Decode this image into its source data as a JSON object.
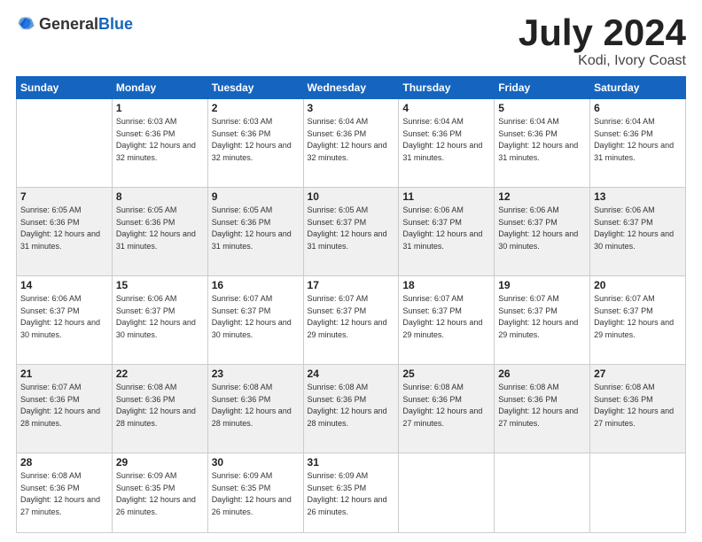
{
  "header": {
    "logo_general": "General",
    "logo_blue": "Blue",
    "month": "July 2024",
    "location": "Kodi, Ivory Coast"
  },
  "weekdays": [
    "Sunday",
    "Monday",
    "Tuesday",
    "Wednesday",
    "Thursday",
    "Friday",
    "Saturday"
  ],
  "weeks": [
    [
      {
        "day": "",
        "sunrise": "",
        "sunset": "",
        "daylight": ""
      },
      {
        "day": "1",
        "sunrise": "Sunrise: 6:03 AM",
        "sunset": "Sunset: 6:36 PM",
        "daylight": "Daylight: 12 hours and 32 minutes."
      },
      {
        "day": "2",
        "sunrise": "Sunrise: 6:03 AM",
        "sunset": "Sunset: 6:36 PM",
        "daylight": "Daylight: 12 hours and 32 minutes."
      },
      {
        "day": "3",
        "sunrise": "Sunrise: 6:04 AM",
        "sunset": "Sunset: 6:36 PM",
        "daylight": "Daylight: 12 hours and 32 minutes."
      },
      {
        "day": "4",
        "sunrise": "Sunrise: 6:04 AM",
        "sunset": "Sunset: 6:36 PM",
        "daylight": "Daylight: 12 hours and 31 minutes."
      },
      {
        "day": "5",
        "sunrise": "Sunrise: 6:04 AM",
        "sunset": "Sunset: 6:36 PM",
        "daylight": "Daylight: 12 hours and 31 minutes."
      },
      {
        "day": "6",
        "sunrise": "Sunrise: 6:04 AM",
        "sunset": "Sunset: 6:36 PM",
        "daylight": "Daylight: 12 hours and 31 minutes."
      }
    ],
    [
      {
        "day": "7",
        "sunrise": "Sunrise: 6:05 AM",
        "sunset": "Sunset: 6:36 PM",
        "daylight": "Daylight: 12 hours and 31 minutes."
      },
      {
        "day": "8",
        "sunrise": "Sunrise: 6:05 AM",
        "sunset": "Sunset: 6:36 PM",
        "daylight": "Daylight: 12 hours and 31 minutes."
      },
      {
        "day": "9",
        "sunrise": "Sunrise: 6:05 AM",
        "sunset": "Sunset: 6:36 PM",
        "daylight": "Daylight: 12 hours and 31 minutes."
      },
      {
        "day": "10",
        "sunrise": "Sunrise: 6:05 AM",
        "sunset": "Sunset: 6:37 PM",
        "daylight": "Daylight: 12 hours and 31 minutes."
      },
      {
        "day": "11",
        "sunrise": "Sunrise: 6:06 AM",
        "sunset": "Sunset: 6:37 PM",
        "daylight": "Daylight: 12 hours and 31 minutes."
      },
      {
        "day": "12",
        "sunrise": "Sunrise: 6:06 AM",
        "sunset": "Sunset: 6:37 PM",
        "daylight": "Daylight: 12 hours and 30 minutes."
      },
      {
        "day": "13",
        "sunrise": "Sunrise: 6:06 AM",
        "sunset": "Sunset: 6:37 PM",
        "daylight": "Daylight: 12 hours and 30 minutes."
      }
    ],
    [
      {
        "day": "14",
        "sunrise": "Sunrise: 6:06 AM",
        "sunset": "Sunset: 6:37 PM",
        "daylight": "Daylight: 12 hours and 30 minutes."
      },
      {
        "day": "15",
        "sunrise": "Sunrise: 6:06 AM",
        "sunset": "Sunset: 6:37 PM",
        "daylight": "Daylight: 12 hours and 30 minutes."
      },
      {
        "day": "16",
        "sunrise": "Sunrise: 6:07 AM",
        "sunset": "Sunset: 6:37 PM",
        "daylight": "Daylight: 12 hours and 30 minutes."
      },
      {
        "day": "17",
        "sunrise": "Sunrise: 6:07 AM",
        "sunset": "Sunset: 6:37 PM",
        "daylight": "Daylight: 12 hours and 29 minutes."
      },
      {
        "day": "18",
        "sunrise": "Sunrise: 6:07 AM",
        "sunset": "Sunset: 6:37 PM",
        "daylight": "Daylight: 12 hours and 29 minutes."
      },
      {
        "day": "19",
        "sunrise": "Sunrise: 6:07 AM",
        "sunset": "Sunset: 6:37 PM",
        "daylight": "Daylight: 12 hours and 29 minutes."
      },
      {
        "day": "20",
        "sunrise": "Sunrise: 6:07 AM",
        "sunset": "Sunset: 6:37 PM",
        "daylight": "Daylight: 12 hours and 29 minutes."
      }
    ],
    [
      {
        "day": "21",
        "sunrise": "Sunrise: 6:07 AM",
        "sunset": "Sunset: 6:36 PM",
        "daylight": "Daylight: 12 hours and 28 minutes."
      },
      {
        "day": "22",
        "sunrise": "Sunrise: 6:08 AM",
        "sunset": "Sunset: 6:36 PM",
        "daylight": "Daylight: 12 hours and 28 minutes."
      },
      {
        "day": "23",
        "sunrise": "Sunrise: 6:08 AM",
        "sunset": "Sunset: 6:36 PM",
        "daylight": "Daylight: 12 hours and 28 minutes."
      },
      {
        "day": "24",
        "sunrise": "Sunrise: 6:08 AM",
        "sunset": "Sunset: 6:36 PM",
        "daylight": "Daylight: 12 hours and 28 minutes."
      },
      {
        "day": "25",
        "sunrise": "Sunrise: 6:08 AM",
        "sunset": "Sunset: 6:36 PM",
        "daylight": "Daylight: 12 hours and 27 minutes."
      },
      {
        "day": "26",
        "sunrise": "Sunrise: 6:08 AM",
        "sunset": "Sunset: 6:36 PM",
        "daylight": "Daylight: 12 hours and 27 minutes."
      },
      {
        "day": "27",
        "sunrise": "Sunrise: 6:08 AM",
        "sunset": "Sunset: 6:36 PM",
        "daylight": "Daylight: 12 hours and 27 minutes."
      }
    ],
    [
      {
        "day": "28",
        "sunrise": "Sunrise: 6:08 AM",
        "sunset": "Sunset: 6:36 PM",
        "daylight": "Daylight: 12 hours and 27 minutes."
      },
      {
        "day": "29",
        "sunrise": "Sunrise: 6:09 AM",
        "sunset": "Sunset: 6:35 PM",
        "daylight": "Daylight: 12 hours and 26 minutes."
      },
      {
        "day": "30",
        "sunrise": "Sunrise: 6:09 AM",
        "sunset": "Sunset: 6:35 PM",
        "daylight": "Daylight: 12 hours and 26 minutes."
      },
      {
        "day": "31",
        "sunrise": "Sunrise: 6:09 AM",
        "sunset": "Sunset: 6:35 PM",
        "daylight": "Daylight: 12 hours and 26 minutes."
      },
      {
        "day": "",
        "sunrise": "",
        "sunset": "",
        "daylight": ""
      },
      {
        "day": "",
        "sunrise": "",
        "sunset": "",
        "daylight": ""
      },
      {
        "day": "",
        "sunrise": "",
        "sunset": "",
        "daylight": ""
      }
    ]
  ]
}
